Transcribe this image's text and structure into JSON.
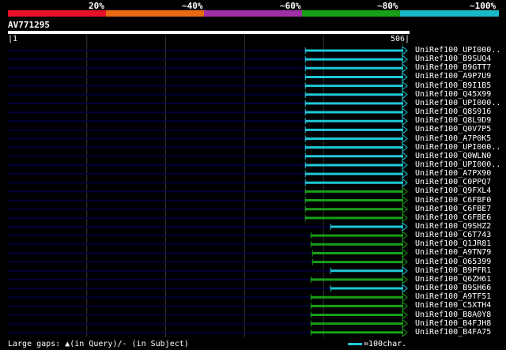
{
  "identity_legend": {
    "segments": [
      {
        "color": "#e8102a"
      },
      {
        "color": "#e86a12"
      },
      {
        "color": "#a030a8"
      },
      {
        "color": "#18a018"
      },
      {
        "color": "#18b8c8"
      }
    ],
    "labels": [
      "20%",
      "~40%",
      "~60%",
      "~80%",
      "~100%"
    ]
  },
  "query": {
    "id": "AV771295",
    "start_tick": "|1",
    "end_tick": "506|",
    "length": 506
  },
  "colors": {
    "cyan": "#1ec8d8",
    "green": "#18a018",
    "track": "#00003a",
    "grid": "#333333"
  },
  "hits": [
    {
      "label": "UniRef100_UPI000..",
      "start": 378,
      "end": 506,
      "color": "cyan",
      "track_start": 1
    },
    {
      "label": "UniRef100_B9SUQ4",
      "start": 378,
      "end": 506,
      "color": "cyan",
      "track_start": 1
    },
    {
      "label": "UniRef100_B9GTT7",
      "start": 378,
      "end": 506,
      "color": "cyan",
      "track_start": 1
    },
    {
      "label": "UniRef100_A9P7U9",
      "start": 378,
      "end": 506,
      "color": "cyan",
      "track_start": 1
    },
    {
      "label": "UniRef100_B9I1B5",
      "start": 378,
      "end": 506,
      "color": "cyan",
      "track_start": 1
    },
    {
      "label": "UniRef100_Q45X99",
      "start": 378,
      "end": 506,
      "color": "cyan",
      "track_start": 1
    },
    {
      "label": "UniRef100_UPI000..",
      "start": 378,
      "end": 506,
      "color": "cyan",
      "track_start": 1
    },
    {
      "label": "UniRef100_Q8S916",
      "start": 378,
      "end": 506,
      "color": "cyan",
      "track_start": 1
    },
    {
      "label": "UniRef100_Q8L9D9",
      "start": 378,
      "end": 506,
      "color": "cyan",
      "track_start": 1
    },
    {
      "label": "UniRef100_Q0V7P5",
      "start": 378,
      "end": 506,
      "color": "cyan",
      "track_start": 1
    },
    {
      "label": "UniRef100_A7P0K5",
      "start": 378,
      "end": 506,
      "color": "cyan",
      "track_start": 1
    },
    {
      "label": "UniRef100_UPI000..",
      "start": 378,
      "end": 506,
      "color": "cyan",
      "track_start": 1
    },
    {
      "label": "UniRef100_Q0WLN0",
      "start": 378,
      "end": 506,
      "color": "cyan",
      "track_start": 1
    },
    {
      "label": "UniRef100_UPI000..",
      "start": 378,
      "end": 506,
      "color": "cyan",
      "track_start": 1
    },
    {
      "label": "UniRef100_A7PX90",
      "start": 378,
      "end": 506,
      "color": "cyan",
      "track_start": 1
    },
    {
      "label": "UniRef100_C0PPQ7",
      "start": 378,
      "end": 506,
      "color": "cyan",
      "track_start": 1
    },
    {
      "label": "UniRef100_Q9FXL4",
      "start": 378,
      "end": 506,
      "color": "green",
      "track_start": 1
    },
    {
      "label": "UniRef100_C6FBF0",
      "start": 378,
      "end": 506,
      "color": "green",
      "track_start": 1
    },
    {
      "label": "UniRef100_C6FBE7",
      "start": 378,
      "end": 506,
      "color": "green",
      "track_start": 1
    },
    {
      "label": "UniRef100_C6FBE6",
      "start": 378,
      "end": 506,
      "color": "green",
      "track_start": 1
    },
    {
      "label": "UniRef100_Q9SHZ2",
      "start": 410,
      "end": 506,
      "color": "cyan",
      "track_start": 1
    },
    {
      "label": "UniRef100_C6T743",
      "start": 385,
      "end": 506,
      "color": "green",
      "track_start": 1
    },
    {
      "label": "UniRef100_Q1JR81",
      "start": 385,
      "end": 506,
      "color": "green",
      "track_start": 1
    },
    {
      "label": "UniRef100_A9TN79",
      "start": 387,
      "end": 506,
      "color": "green",
      "track_start": 1
    },
    {
      "label": "UniRef100_O65399",
      "start": 387,
      "end": 506,
      "color": "green",
      "track_start": 1
    },
    {
      "label": "UniRef100_B9PFR1",
      "start": 410,
      "end": 506,
      "color": "cyan",
      "track_start": 1
    },
    {
      "label": "UniRef100_Q6ZH61",
      "start": 385,
      "end": 506,
      "color": "green",
      "track_start": 1
    },
    {
      "label": "UniRef100_B9SH66",
      "start": 410,
      "end": 506,
      "color": "cyan",
      "track_start": 1
    },
    {
      "label": "UniRef100_A9TF51",
      "start": 385,
      "end": 506,
      "color": "green",
      "track_start": 1
    },
    {
      "label": "UniRef100_C5XTH4",
      "start": 385,
      "end": 506,
      "color": "green",
      "track_start": 1
    },
    {
      "label": "UniRef100_B8A0Y8",
      "start": 385,
      "end": 506,
      "color": "green",
      "track_start": 1
    },
    {
      "label": "UniRef100_B4FJH8",
      "start": 385,
      "end": 506,
      "color": "green",
      "track_start": 1
    },
    {
      "label": "UniRef100_B4FA75",
      "start": 385,
      "end": 506,
      "color": "green",
      "track_start": 1
    }
  ],
  "legend": {
    "gaps_text": "Large gaps: ▲(in Query)/- (in Subject)",
    "scale_text": "=100char."
  }
}
